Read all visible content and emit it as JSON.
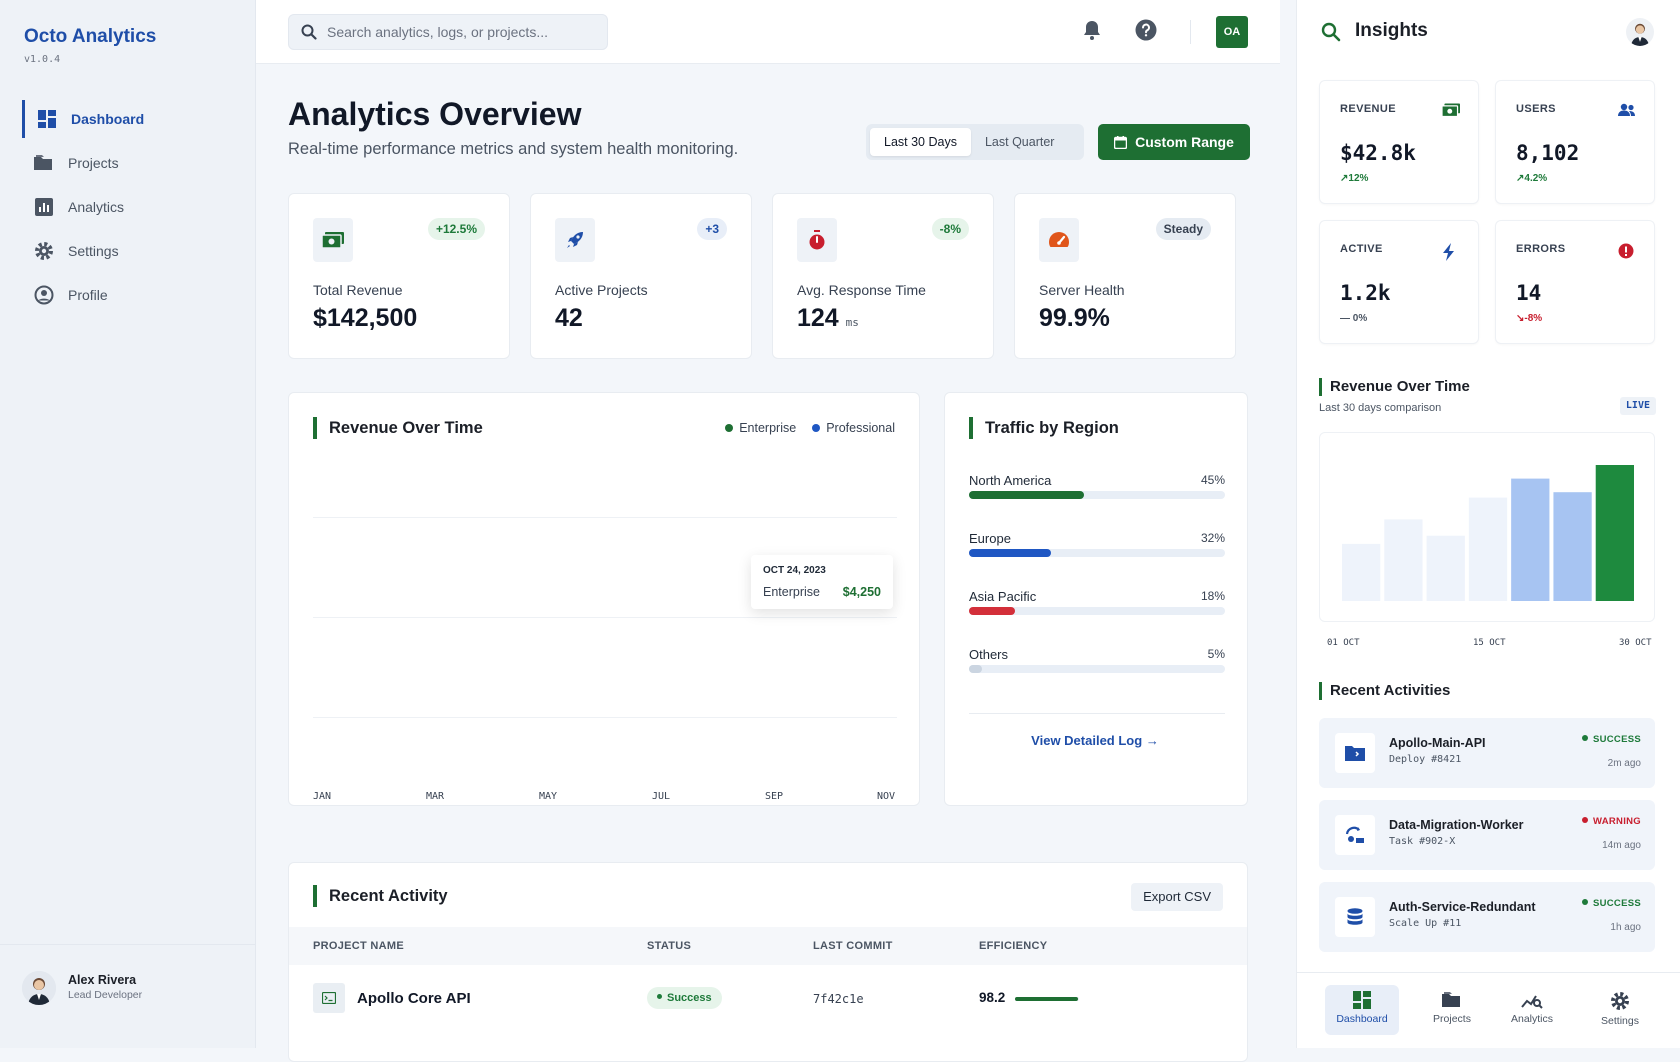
{
  "app": {
    "name": "Octo Analytics",
    "version": "v1.0.4"
  },
  "sidebar": {
    "items": [
      {
        "label": "Dashboard",
        "icon": "grid-icon",
        "active": true
      },
      {
        "label": "Projects",
        "icon": "folder-icon"
      },
      {
        "label": "Analytics",
        "icon": "bar-chart-icon"
      },
      {
        "label": "Settings",
        "icon": "gear-icon"
      },
      {
        "label": "Profile",
        "icon": "user-circle-icon"
      }
    ],
    "user": {
      "name": "Alex Rivera",
      "role": "Lead Developer"
    }
  },
  "topbar": {
    "search_placeholder": "Search analytics, logs, or projects...",
    "avatar_initials": "OA"
  },
  "header": {
    "title": "Analytics Overview",
    "subtitle": "Real-time performance metrics and system health monitoring.",
    "ranges": [
      "Last 30 Days",
      "Last Quarter"
    ],
    "custom_range": "Custom Range"
  },
  "kpis": [
    {
      "label": "Total Revenue",
      "value": "$142,500",
      "unit": "",
      "badge": "+12.5%",
      "icon": "cash-icon",
      "color": "#1e6f33"
    },
    {
      "label": "Active Projects",
      "value": "42",
      "unit": "",
      "badge": "+3",
      "icon": "rocket-icon",
      "color": "#1f4ea8"
    },
    {
      "label": "Avg. Response Time",
      "value": "124",
      "unit": "ms",
      "badge": "-8%",
      "icon": "stopwatch-icon",
      "color": "#c81e2e"
    },
    {
      "label": "Server Health",
      "value": "99.9%",
      "unit": "",
      "badge": "Steady",
      "icon": "speedometer-icon",
      "color": "#e0561b"
    }
  ],
  "revenue_chart": {
    "title": "Revenue Over Time",
    "legend": [
      {
        "name": "Enterprise",
        "color": "#1e6f33"
      },
      {
        "name": "Professional",
        "color": "#1f57c3"
      }
    ],
    "x_ticks": [
      "JAN",
      "MAR",
      "MAY",
      "JUL",
      "SEP",
      "NOV"
    ],
    "tooltip": {
      "date": "OCT 24, 2023",
      "series": "Enterprise",
      "value": "$4,250"
    }
  },
  "traffic": {
    "title": "Traffic by Region",
    "regions": [
      {
        "name": "North America",
        "pct_label": "45%",
        "pct": 45,
        "color": "#1e6f33"
      },
      {
        "name": "Europe",
        "pct_label": "32%",
        "pct": 32,
        "color": "#1f57c3"
      },
      {
        "name": "Asia Pacific",
        "pct_label": "18%",
        "pct": 18,
        "color": "#d32f3a"
      },
      {
        "name": "Others",
        "pct_label": "5%",
        "pct": 5,
        "color": "#cbd5e1"
      }
    ],
    "link": "View Detailed Log"
  },
  "activity_table": {
    "title": "Recent Activity",
    "export": "Export CSV",
    "columns": [
      "PROJECT NAME",
      "STATUS",
      "LAST COMMIT",
      "EFFICIENCY"
    ],
    "rows": [
      {
        "name": "Apollo Core API",
        "status": "Success",
        "commit": "7f42c1e",
        "efficiency": "98.2",
        "efficiency_pct": 98.2
      }
    ]
  },
  "insights": {
    "title": "Insights",
    "cards": [
      {
        "label": "REVENUE",
        "value": "$42.8k",
        "delta": "12%",
        "trend": "up",
        "icon": "cash-icon",
        "color": "#1e6f33"
      },
      {
        "label": "USERS",
        "value": "8,102",
        "delta": "4.2%",
        "trend": "up",
        "icon": "users-icon",
        "color": "#1f4ea8"
      },
      {
        "label": "ACTIVE",
        "value": "1.2k",
        "delta": "0%",
        "trend": "flat",
        "icon": "bolt-icon",
        "color": "#1f4ea8"
      },
      {
        "label": "ERRORS",
        "value": "14",
        "delta": "-8%",
        "trend": "down",
        "icon": "alert-icon",
        "color": "#c81e2e"
      }
    ],
    "chart": {
      "title": "Revenue Over Time",
      "subtitle": "Last 30 days comparison",
      "badge": "LIVE",
      "x_ticks": [
        "01 OCT",
        "15 OCT",
        "30 OCT"
      ],
      "bars": [
        0.42,
        0.6,
        0.48,
        0.76,
        0.9,
        0.8,
        1.0
      ]
    },
    "activities_title": "Recent Activities",
    "activities": [
      {
        "name": "Apollo-Main-API",
        "sub": "Deploy #8421",
        "status": "SUCCESS",
        "time": "2m ago",
        "icon": "folder-code-icon",
        "color": "#1e6f33"
      },
      {
        "name": "Data-Migration-Worker",
        "sub": "Task #902-X",
        "status": "WARNING",
        "time": "14m ago",
        "icon": "sync-icon",
        "color": "#c81e2e"
      },
      {
        "name": "Auth-Service-Redundant",
        "sub": "Scale Up #11",
        "status": "SUCCESS",
        "time": "1h ago",
        "icon": "database-icon",
        "color": "#1e6f33"
      }
    ]
  },
  "bottom_nav": [
    {
      "label": "Dashboard",
      "icon": "grid-icon",
      "active": true
    },
    {
      "label": "Projects",
      "icon": "folder-icon"
    },
    {
      "label": "Analytics",
      "icon": "analytics-icon"
    },
    {
      "label": "Settings",
      "icon": "gear-icon"
    }
  ]
}
